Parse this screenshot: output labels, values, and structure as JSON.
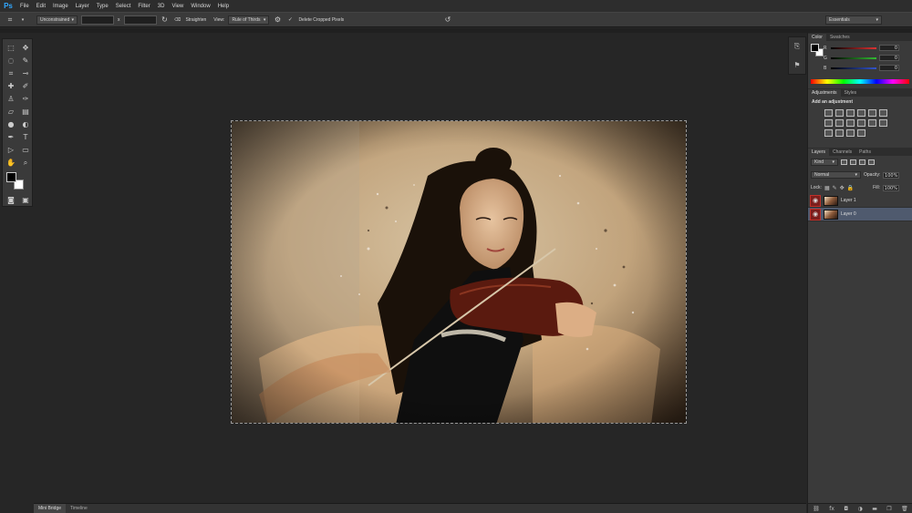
{
  "app": {
    "logo": "Ps"
  },
  "menu": [
    "File",
    "Edit",
    "Image",
    "Layer",
    "Type",
    "Select",
    "Filter",
    "3D",
    "View",
    "Window",
    "Help"
  ],
  "options": {
    "ratio": "Unconstrained",
    "ratio_x": "x",
    "straighten": "Straighten",
    "view_label": "View:",
    "overlay": "Rule of Thirds",
    "delete_cropped": "Delete Cropped Pixels",
    "workspace": "Essentials",
    "check": "✓"
  },
  "color_panel": {
    "tabs": [
      "Color",
      "Swatches"
    ],
    "sliders": [
      {
        "letter": "R",
        "value": "0",
        "color": "#d33"
      },
      {
        "letter": "G",
        "value": "0",
        "color": "#3b3"
      },
      {
        "letter": "B",
        "value": "0",
        "color": "#35c"
      }
    ]
  },
  "adjustments_panel": {
    "tabs": [
      "Adjustments",
      "Styles"
    ],
    "heading": "Add an adjustment"
  },
  "layers_panel": {
    "tabs": [
      "Layers",
      "Channels",
      "Paths"
    ],
    "kind": "Kind",
    "blend_mode": "Normal",
    "opacity_label": "Opacity:",
    "opacity": "100%",
    "lock_label": "Lock:",
    "fill_label": "Fill:",
    "fill": "100%",
    "layers": [
      {
        "name": "Layer 1",
        "selected": false
      },
      {
        "name": "Layer 0",
        "selected": true
      }
    ],
    "footer_icons": [
      "link-icon",
      "fx-icon",
      "mask-icon",
      "adjustment-icon",
      "folder-icon",
      "new-layer-icon",
      "trash-icon"
    ]
  },
  "statusbar": {
    "tabs": [
      "Mini Bridge",
      "Timeline"
    ]
  },
  "colors": {
    "menubar": "#2d2d2d",
    "panel": "#3a3a3a",
    "accent": "#31a8ff",
    "eye_highlight": "#c0302a",
    "selected_layer": "#4f5a6e"
  }
}
